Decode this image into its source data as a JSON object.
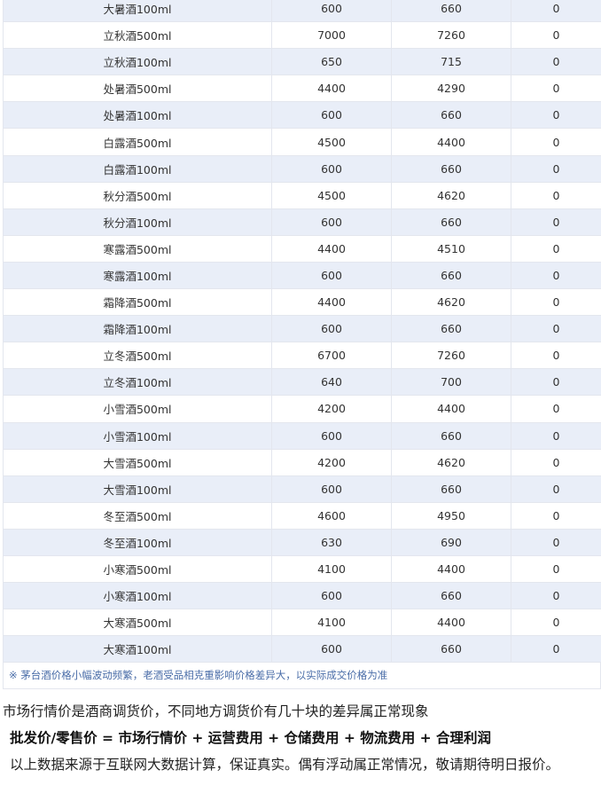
{
  "table": {
    "rows": [
      {
        "name": "大暑酒100ml",
        "a": "600",
        "b": "660",
        "c": "0"
      },
      {
        "name": "立秋酒500ml",
        "a": "7000",
        "b": "7260",
        "c": "0"
      },
      {
        "name": "立秋酒100ml",
        "a": "650",
        "b": "715",
        "c": "0"
      },
      {
        "name": "处暑酒500ml",
        "a": "4400",
        "b": "4290",
        "c": "0"
      },
      {
        "name": "处暑酒100ml",
        "a": "600",
        "b": "660",
        "c": "0"
      },
      {
        "name": "白露酒500ml",
        "a": "4500",
        "b": "4400",
        "c": "0"
      },
      {
        "name": "白露酒100ml",
        "a": "600",
        "b": "660",
        "c": "0"
      },
      {
        "name": "秋分酒500ml",
        "a": "4500",
        "b": "4620",
        "c": "0"
      },
      {
        "name": "秋分酒100ml",
        "a": "600",
        "b": "660",
        "c": "0"
      },
      {
        "name": "寒露酒500ml",
        "a": "4400",
        "b": "4510",
        "c": "0"
      },
      {
        "name": "寒露酒100ml",
        "a": "600",
        "b": "660",
        "c": "0"
      },
      {
        "name": "霜降酒500ml",
        "a": "4400",
        "b": "4620",
        "c": "0"
      },
      {
        "name": "霜降酒100ml",
        "a": "600",
        "b": "660",
        "c": "0"
      },
      {
        "name": "立冬酒500ml",
        "a": "6700",
        "b": "7260",
        "c": "0"
      },
      {
        "name": "立冬酒100ml",
        "a": "640",
        "b": "700",
        "c": "0"
      },
      {
        "name": "小雪酒500ml",
        "a": "4200",
        "b": "4400",
        "c": "0"
      },
      {
        "name": "小雪酒100ml",
        "a": "600",
        "b": "660",
        "c": "0"
      },
      {
        "name": "大雪酒500ml",
        "a": "4200",
        "b": "4620",
        "c": "0"
      },
      {
        "name": "大雪酒100ml",
        "a": "600",
        "b": "660",
        "c": "0"
      },
      {
        "name": "冬至酒500ml",
        "a": "4600",
        "b": "4950",
        "c": "0"
      },
      {
        "name": "冬至酒100ml",
        "a": "630",
        "b": "690",
        "c": "0"
      },
      {
        "name": "小寒酒500ml",
        "a": "4100",
        "b": "4400",
        "c": "0"
      },
      {
        "name": "小寒酒100ml",
        "a": "600",
        "b": "660",
        "c": "0"
      },
      {
        "name": "大寒酒500ml",
        "a": "4100",
        "b": "4400",
        "c": "0"
      },
      {
        "name": "大寒酒100ml",
        "a": "600",
        "b": "660",
        "c": "0"
      }
    ],
    "footnote": "※ 茅台酒价格小幅波动频繁，老酒受品相克重影响价格差异大，以实际成交价格为准"
  },
  "text": {
    "line1": "市场行情价是酒商调货价，不同地方调货价有几十块的差异属正常现象",
    "line2": "批发价/零售价 = 市场行情价 + 运营费用 + 仓储费用 + 物流费用 + 合理利润",
    "line3": "以上数据来源于互联网大数据计算，保证真实。偶有浮动属正常情况，敬请期待明日报价。"
  },
  "colors": {
    "row_stripe": "#e9eef8",
    "border": "#e3e6ee",
    "footnote_text": "#4a6da8"
  }
}
